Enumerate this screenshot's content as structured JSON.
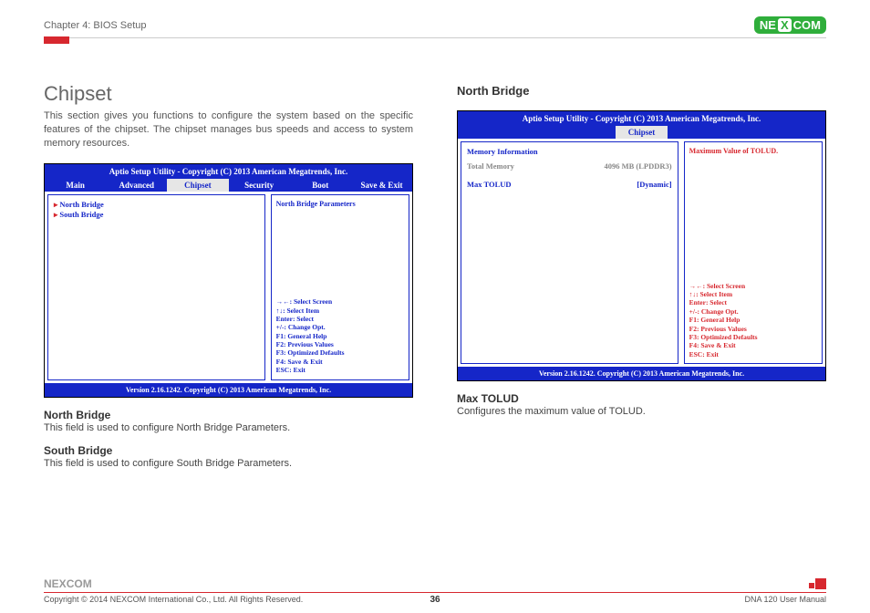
{
  "header": {
    "chapter": "Chapter 4: BIOS Setup",
    "brand_left": "NE",
    "brand_x": "X",
    "brand_right": "COM"
  },
  "left": {
    "title": "Chipset",
    "intro": "This section gives you functions to configure the system based on the specific features of the chipset. The chipset manages bus speeds and access to system memory resources.",
    "bios": {
      "title": "Aptio Setup Utility - Copyright (C) 2013 American Megatrends, Inc.",
      "tabs": [
        "Main",
        "Advanced",
        "Chipset",
        "Security",
        "Boot",
        "Save & Exit"
      ],
      "active_tab": "Chipset",
      "items": [
        "North Bridge",
        "South Bridge"
      ],
      "help": "North Bridge Parameters",
      "keys": [
        "→←: Select Screen",
        "↑↓: Select Item",
        "Enter: Select",
        "+/-: Change Opt.",
        "F1: General Help",
        "F2: Previous Values",
        "F3: Optimized Defaults",
        "F4: Save & Exit",
        "ESC: Exit"
      ],
      "footer": "Version 2.16.1242. Copyright (C) 2013 American Megatrends, Inc."
    },
    "nb_h": "North Bridge",
    "nb_p": "This field is used to configure North Bridge Parameters.",
    "sb_h": "South Bridge",
    "sb_p": "This field is used to configure South Bridge Parameters."
  },
  "right": {
    "title": "North Bridge",
    "bios": {
      "title": "Aptio Setup Utility - Copyright (C) 2013 American Megatrends, Inc.",
      "tab": "Chipset",
      "mem_h": "Memory Information",
      "row1_l": "Total Memory",
      "row1_v": "4096 MB (LPDDR3)",
      "row2_l": "Max TOLUD",
      "row2_v": "[Dynamic]",
      "help": "Maximum Value of TOLUD.",
      "keys": [
        "→←: Select Screen",
        "↑↓: Select Item",
        "Enter: Select",
        "+/-: Change Opt.",
        "F1: General Help",
        "F2: Previous Values",
        "F3: Optimized Defaults",
        "F4: Save & Exit",
        "ESC: Exit"
      ],
      "footer": "Version 2.16.1242. Copyright (C) 2013 American Megatrends, Inc."
    },
    "mt_h": "Max TOLUD",
    "mt_p": "Configures the maximum value of TOLUD."
  },
  "footer": {
    "copyright": "Copyright © 2014 NEXCOM International Co., Ltd. All Rights Reserved.",
    "page": "36",
    "manual": "DNA 120 User Manual"
  }
}
